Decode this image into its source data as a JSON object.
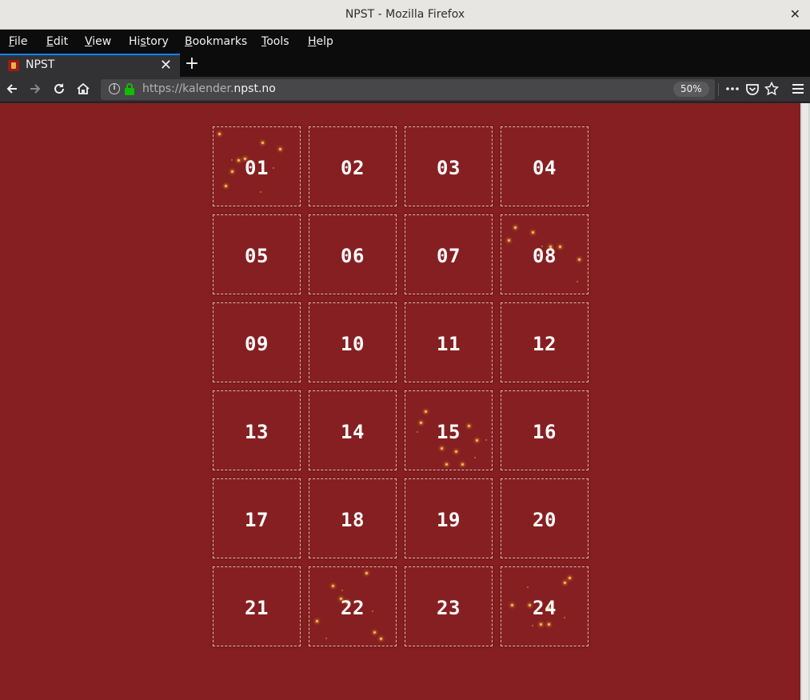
{
  "window": {
    "title": "NPST - Mozilla Firefox",
    "close_glyph": "✕"
  },
  "menu": [
    {
      "pre": "",
      "key": "F",
      "post": "ile"
    },
    {
      "pre": "",
      "key": "E",
      "post": "dit"
    },
    {
      "pre": "",
      "key": "V",
      "post": "iew"
    },
    {
      "pre": "Hi",
      "key": "s",
      "post": "tory"
    },
    {
      "pre": "",
      "key": "B",
      "post": "ookmarks"
    },
    {
      "pre": "",
      "key": "T",
      "post": "ools"
    },
    {
      "pre": "",
      "key": "H",
      "post": "elp"
    }
  ],
  "tab": {
    "label": "NPST",
    "close_glyph": "✕",
    "new_tab_glyph": "+"
  },
  "nav": {
    "url_prefix": "https://kalender.",
    "url_domain": "npst.no",
    "zoom": "50%",
    "icons": [
      "back-icon",
      "forward-icon",
      "reload-icon",
      "home-icon",
      "info-icon",
      "lock-icon",
      "page-actions-icon",
      "pocket-icon",
      "bookmark-star-icon",
      "hamburger-menu-icon"
    ]
  },
  "page": {
    "background": "#861f21",
    "doors": [
      "01",
      "02",
      "03",
      "04",
      "05",
      "06",
      "07",
      "08",
      "09",
      "10",
      "11",
      "12",
      "13",
      "14",
      "15",
      "16",
      "17",
      "18",
      "19",
      "20",
      "21",
      "22",
      "23",
      "24"
    ],
    "sparkle_doors": [
      "01",
      "08",
      "15",
      "22",
      "24"
    ]
  }
}
